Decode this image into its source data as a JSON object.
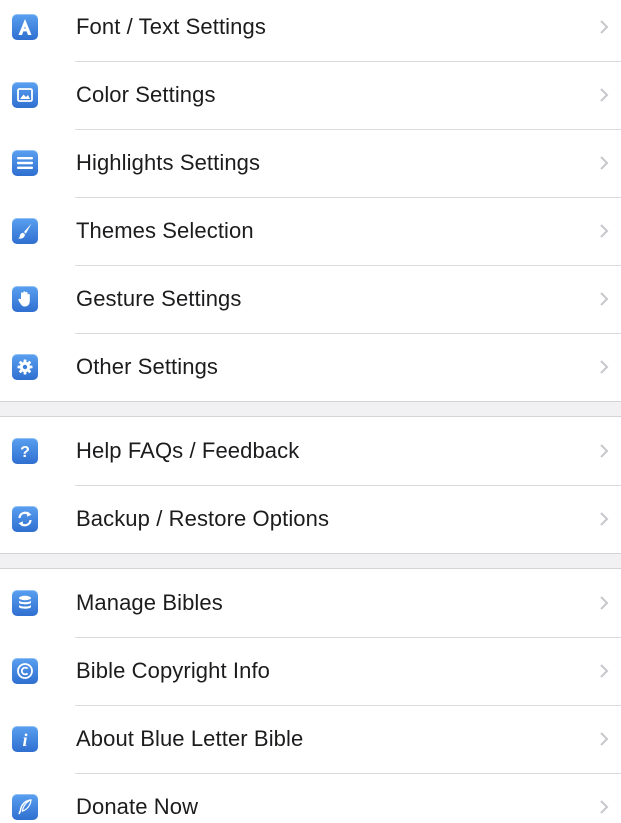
{
  "groups": [
    {
      "items": [
        {
          "label": "Font / Text Settings",
          "icon": "font-a-icon"
        },
        {
          "label": "Color Settings",
          "icon": "color-picture-icon"
        },
        {
          "label": "Highlights Settings",
          "icon": "highlight-lines-icon"
        },
        {
          "label": "Themes Selection",
          "icon": "brush-icon"
        },
        {
          "label": "Gesture Settings",
          "icon": "hand-icon"
        },
        {
          "label": "Other Settings",
          "icon": "gear-icon"
        }
      ]
    },
    {
      "items": [
        {
          "label": "Help FAQs / Feedback",
          "icon": "question-icon"
        },
        {
          "label": "Backup / Restore Options",
          "icon": "sync-arrows-icon"
        }
      ]
    },
    {
      "items": [
        {
          "label": "Manage Bibles",
          "icon": "database-icon"
        },
        {
          "label": "Bible Copyright Info",
          "icon": "copyright-icon"
        },
        {
          "label": "About Blue Letter Bible",
          "icon": "info-icon"
        },
        {
          "label": "Donate Now",
          "icon": "feather-icon"
        }
      ]
    }
  ],
  "colors": {
    "icon_blue": "#3b7ede",
    "chevron": "#c7c7cc",
    "separator": "#dcdcdf",
    "background": "#f1f1f3"
  }
}
